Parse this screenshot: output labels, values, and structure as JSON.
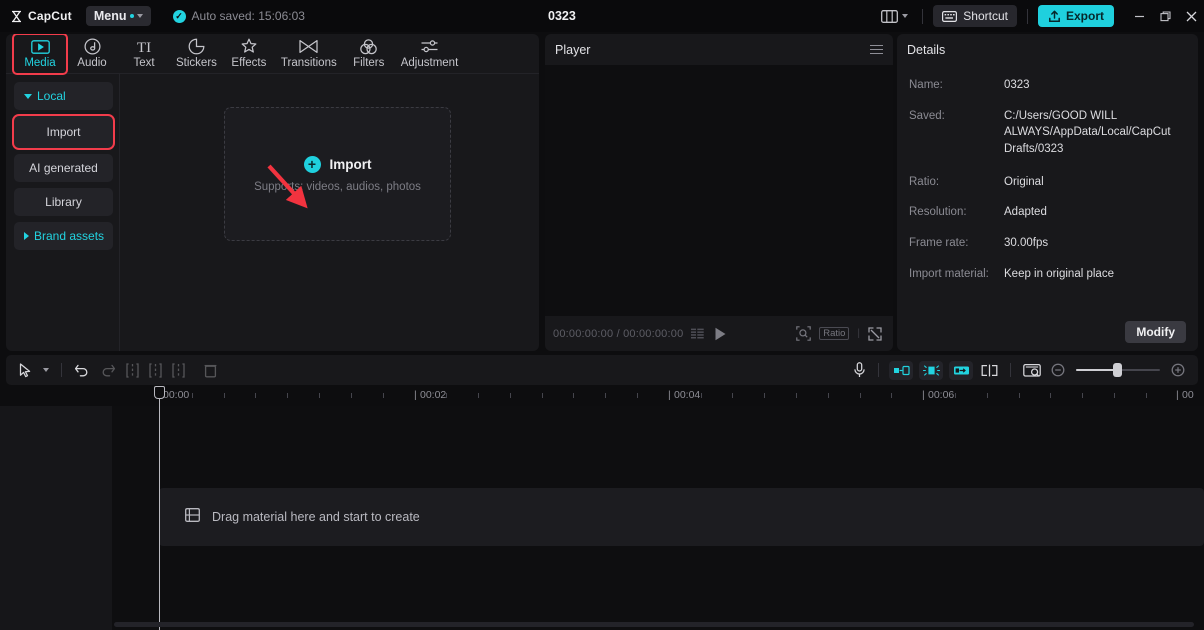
{
  "titlebar": {
    "brand": "CapCut",
    "menu_label": "Menu",
    "autosave": "Auto saved: 15:06:03",
    "project_title": "0323",
    "layout_icon": "layout-panels-icon",
    "shortcut_label": "Shortcut",
    "export_label": "Export",
    "minimize": "–",
    "maximize": "❐",
    "close": "✕"
  },
  "media_tabs": [
    {
      "label": "Media",
      "icon": "media-icon",
      "active": true
    },
    {
      "label": "Audio",
      "icon": "audio-icon",
      "active": false
    },
    {
      "label": "Text",
      "icon": "text-icon",
      "active": false
    },
    {
      "label": "Stickers",
      "icon": "stickers-icon",
      "active": false
    },
    {
      "label": "Effects",
      "icon": "effects-icon",
      "active": false
    },
    {
      "label": "Transitions",
      "icon": "transitions-icon",
      "active": false
    },
    {
      "label": "Filters",
      "icon": "filters-icon",
      "active": false
    },
    {
      "label": "Adjustment",
      "icon": "adjustment-icon",
      "active": false
    }
  ],
  "sidebar": {
    "items": [
      {
        "label": "Local",
        "type": "group-expanded",
        "highlighted": false
      },
      {
        "label": "Import",
        "type": "item",
        "highlighted": true
      },
      {
        "label": "AI generated",
        "type": "item",
        "highlighted": false
      },
      {
        "label": "Library",
        "type": "item",
        "highlighted": false
      },
      {
        "label": "Brand assets",
        "type": "group-collapsed",
        "highlighted": false
      }
    ]
  },
  "dropzone": {
    "label": "Import",
    "sub": "Supports: videos, audios, photos",
    "plus_icon": "plus-circle-icon"
  },
  "player": {
    "title": "Player",
    "menu_icon": "hamburger-icon",
    "current_time": "00:00:00:00",
    "total_time": "00:00:00:00",
    "time_display": "00:00:00:00 / 00:00:00:00",
    "play_icon": "play-icon",
    "list_icon": "list-icon",
    "magnifier_icon": "magnifier-icon",
    "ratio_label": "Ratio",
    "fullscreen_icon": "fullscreen-icon"
  },
  "details": {
    "title": "Details",
    "rows": [
      {
        "key": "Name:",
        "value": "0323"
      },
      {
        "key": "Saved:",
        "value": "C:/Users/GOOD WILL ALWAYS/AppData/Local/CapCut Drafts/0323"
      },
      {
        "key": "Ratio:",
        "value": "Original"
      },
      {
        "key": "Resolution:",
        "value": "Adapted"
      },
      {
        "key": "Frame rate:",
        "value": "30.00fps"
      },
      {
        "key": "Import material:",
        "value": "Keep in original place"
      }
    ],
    "modify_label": "Modify"
  },
  "timeline": {
    "tools_left": [
      {
        "name": "cursor-tool",
        "enabled": true
      },
      {
        "name": "cursor-dropdown",
        "enabled": true
      },
      {
        "name": "undo-button",
        "enabled": true
      },
      {
        "name": "redo-button",
        "enabled": false
      },
      {
        "name": "split-left-button",
        "enabled": false
      },
      {
        "name": "split-button",
        "enabled": false
      },
      {
        "name": "split-right-button",
        "enabled": false
      },
      {
        "name": "delete-button",
        "enabled": false
      }
    ],
    "tools_right": [
      {
        "name": "microphone-button",
        "enabled": true
      },
      {
        "name": "keyframe-in-button",
        "enabled": true
      },
      {
        "name": "keyframe-mid-button",
        "enabled": true
      },
      {
        "name": "keyframe-out-button",
        "enabled": true
      },
      {
        "name": "split-clip-button",
        "enabled": true
      },
      {
        "name": "snapshot-button",
        "enabled": true
      },
      {
        "name": "zoom-out-button",
        "enabled": true
      },
      {
        "name": "zoom-in-button",
        "enabled": true
      }
    ],
    "ruler_labels": [
      "00:00",
      "00:02",
      "00:04",
      "00:06",
      "00"
    ],
    "drop_hint": "Drag material here and start to create",
    "drop_icon": "film-strip-icon"
  },
  "annotation": {
    "arrow_color": "#f2333f",
    "highlight_color": "#f23c4b"
  },
  "colors": {
    "accent": "#22d3e0",
    "export_bg": "#1fd0de",
    "panel_bg": "#18181b",
    "app_bg": "#0d0d0f"
  }
}
